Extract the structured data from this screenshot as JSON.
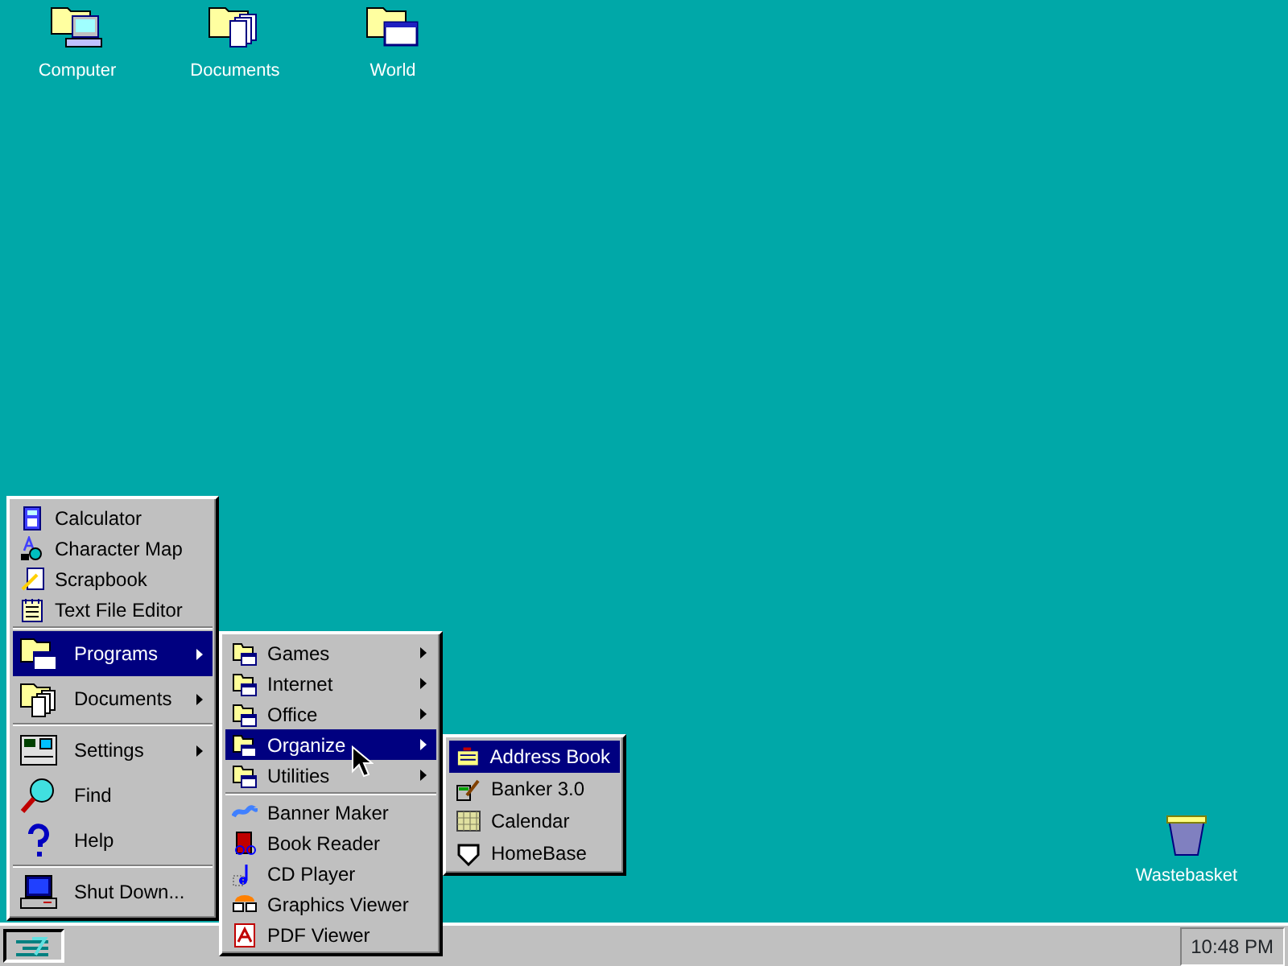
{
  "desktop_icons": [
    {
      "label": "Computer"
    },
    {
      "label": "Documents"
    },
    {
      "label": "World"
    }
  ],
  "wastebasket": {
    "label": "Wastebasket"
  },
  "start_menu": {
    "groups": [
      [
        {
          "label": "Calculator",
          "has_submenu": false,
          "selected": false
        },
        {
          "label": "Character Map",
          "has_submenu": false,
          "selected": false
        },
        {
          "label": "Scrapbook",
          "has_submenu": false,
          "selected": false
        },
        {
          "label": "Text File Editor",
          "has_submenu": false,
          "selected": false
        }
      ],
      [
        {
          "label": "Programs",
          "has_submenu": true,
          "selected": true
        },
        {
          "label": "Documents",
          "has_submenu": true,
          "selected": false
        }
      ],
      [
        {
          "label": "Settings",
          "has_submenu": true,
          "selected": false
        },
        {
          "label": "Find",
          "has_submenu": false,
          "selected": false
        },
        {
          "label": "Help",
          "has_submenu": false,
          "selected": false
        }
      ],
      [
        {
          "label": "Shut Down...",
          "has_submenu": false,
          "selected": false
        }
      ]
    ]
  },
  "programs_menu": {
    "groups": [
      [
        {
          "label": "Games",
          "has_submenu": true,
          "selected": false
        },
        {
          "label": "Internet",
          "has_submenu": true,
          "selected": false
        },
        {
          "label": "Office",
          "has_submenu": true,
          "selected": false
        },
        {
          "label": "Organize",
          "has_submenu": true,
          "selected": true
        },
        {
          "label": "Utilities",
          "has_submenu": true,
          "selected": false
        }
      ],
      [
        {
          "label": "Banner Maker",
          "has_submenu": false,
          "selected": false
        },
        {
          "label": "Book Reader",
          "has_submenu": false,
          "selected": false
        },
        {
          "label": "CD Player",
          "has_submenu": false,
          "selected": false
        },
        {
          "label": "Graphics Viewer",
          "has_submenu": false,
          "selected": false
        },
        {
          "label": "PDF Viewer",
          "has_submenu": false,
          "selected": false
        }
      ]
    ]
  },
  "organize_menu": {
    "groups": [
      [
        {
          "label": "Address Book",
          "has_submenu": false,
          "selected": true
        },
        {
          "label": "Banker 3.0",
          "has_submenu": false,
          "selected": false
        },
        {
          "label": "Calendar",
          "has_submenu": false,
          "selected": false
        },
        {
          "label": "HomeBase",
          "has_submenu": false,
          "selected": false
        }
      ]
    ]
  },
  "taskbar": {
    "clock": "10:48 PM"
  }
}
